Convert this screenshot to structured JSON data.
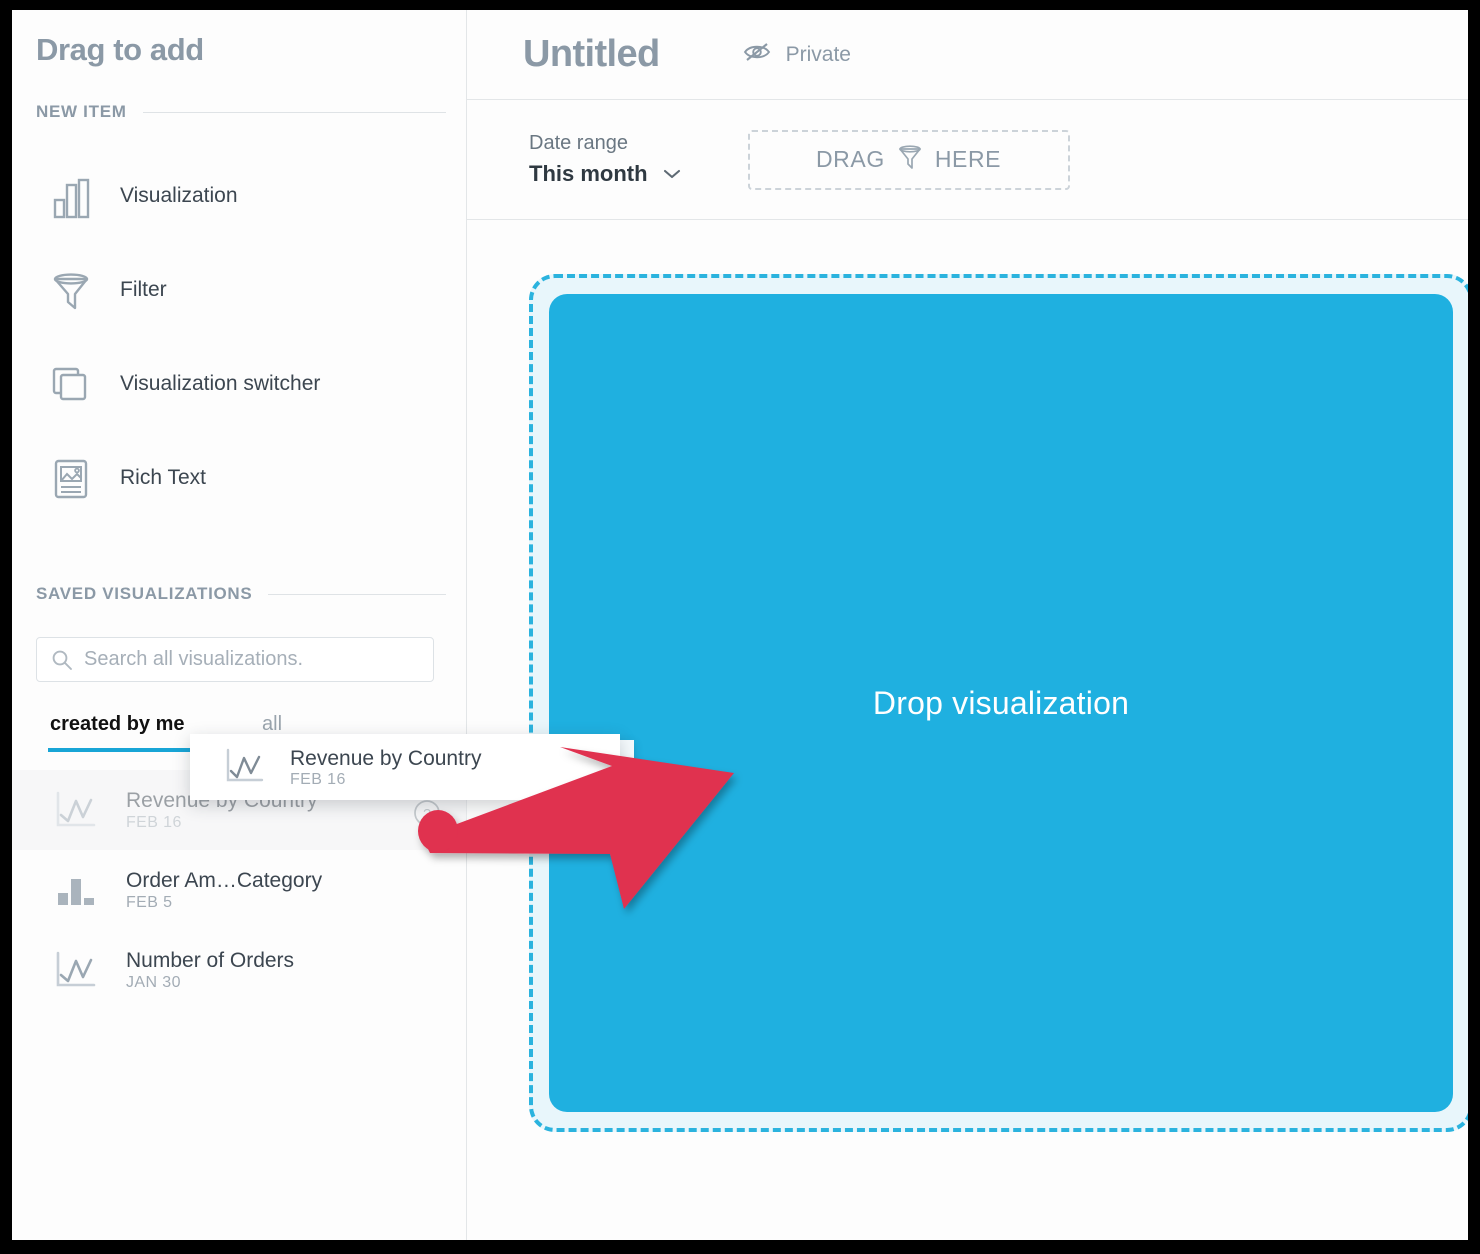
{
  "sidebar": {
    "title": "Drag to add",
    "new_item_section": {
      "heading": "NEW ITEM",
      "items": [
        {
          "label": "Visualization",
          "icon": "bar-chart-icon"
        },
        {
          "label": "Filter",
          "icon": "funnel-icon"
        },
        {
          "label": "Visualization switcher",
          "icon": "stacked-cards-icon"
        },
        {
          "label": "Rich Text",
          "icon": "rich-text-icon"
        }
      ]
    },
    "saved_section": {
      "heading": "SAVED VISUALIZATIONS",
      "search": {
        "placeholder": "Search all visualizations.",
        "value": "",
        "icon": "search-icon"
      },
      "tabs": [
        {
          "label": "created by me",
          "active": true
        },
        {
          "label": "all",
          "active": false
        }
      ],
      "items": [
        {
          "name": "Revenue by Country",
          "date": "FEB 16",
          "icon": "line-chart-icon",
          "help_icon": "help-circle-icon"
        },
        {
          "name": "Order Am…Category",
          "date": "FEB 5",
          "icon": "column-chart-icon",
          "help_icon": "help-circle-icon"
        },
        {
          "name": "Number of Orders",
          "date": "JAN 30",
          "icon": "line-chart-icon",
          "help_icon": "help-circle-icon"
        }
      ]
    }
  },
  "drag_ghost": {
    "name": "Revenue by Country",
    "date": "FEB 16",
    "icon": "line-chart-icon"
  },
  "header": {
    "title": "Untitled",
    "privacy_label": "Private",
    "privacy_icon": "eye-slash-icon"
  },
  "filter_bar": {
    "date_range_caption": "Date range",
    "date_range_value": "This month",
    "date_range_chevron": "chevron-down-icon",
    "drop_filter_prefix": "DRAG",
    "drop_filter_suffix": "HERE",
    "drop_filter_icon": "funnel-icon"
  },
  "canvas": {
    "drop_label": "Drop visualization"
  },
  "annotation": {
    "arrow_color": "#e03050",
    "arrow_name": "red-pointer-arrow"
  },
  "colors": {
    "accent_cyan": "#1fb0e0",
    "drop_border": "#2bb3de",
    "drop_halo": "#e8f6fb",
    "muted_text": "#8b99a6",
    "body_text": "#3c4650",
    "tab_underline": "#18a5d6"
  }
}
